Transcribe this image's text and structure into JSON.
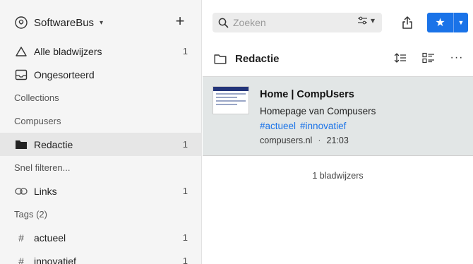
{
  "account": {
    "name": "SoftwareBus",
    "caret": "▾"
  },
  "sidebar": {
    "add_label": "+",
    "items": [
      {
        "label": "Alle bladwijzers",
        "count": "1",
        "icon": "cloud-icon"
      },
      {
        "label": "Ongesorteerd",
        "count": "",
        "icon": "inbox-icon"
      }
    ],
    "collections_heading": "Collections",
    "compusers_heading": "Compusers",
    "folder_items": [
      {
        "label": "Redactie",
        "count": "1",
        "icon": "folder-filled-icon"
      }
    ],
    "filters_heading": "Snel filteren...",
    "filter_items": [
      {
        "label": "Links",
        "count": "1",
        "icon": "link-icon"
      }
    ],
    "tags_heading": "Tags (2)",
    "tag_items": [
      {
        "hash": "#",
        "label": "actueel",
        "count": "1"
      },
      {
        "hash": "#",
        "label": "innovatief",
        "count": "1"
      }
    ]
  },
  "search": {
    "placeholder": "Zoeken",
    "filter_caret": "▾"
  },
  "folder": {
    "title": "Redactie"
  },
  "bookmark": {
    "title": "Home | CompUsers",
    "description": "Homepage van Compusers",
    "tags": [
      "#actueel",
      "#innovatief"
    ],
    "domain": "compusers.nl",
    "separator": "·",
    "time": "21:03"
  },
  "footer": {
    "count_text": "1 bladwijzers"
  },
  "colors": {
    "accent": "#1a73e8",
    "sidebar_bg": "#f5f5f5",
    "selected_bg": "#e2e6e6"
  }
}
